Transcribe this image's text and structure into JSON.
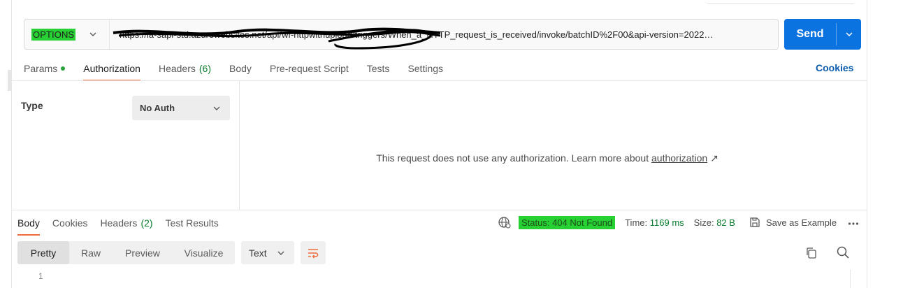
{
  "request": {
    "method": "OPTIONS",
    "url": "https://la-sapi-std.azurewebsites.net/api/wf-httpwithupload/triggers/When_a_HTTP_request_is_received/invoke/batchID%2F00&api-version=2022…",
    "send_label": "Send"
  },
  "request_tabs": [
    {
      "label": "Params"
    },
    {
      "label": "Authorization"
    },
    {
      "label": "Headers",
      "count": "(6)"
    },
    {
      "label": "Body"
    },
    {
      "label": "Pre-request Script"
    },
    {
      "label": "Tests"
    },
    {
      "label": "Settings"
    }
  ],
  "cookies_link": "Cookies",
  "auth": {
    "type_label": "Type",
    "type_value": "No Auth",
    "message": "This request does not use any authorization. Learn more about",
    "link": "authorization",
    "link_arrow": "↗"
  },
  "response_tabs": [
    {
      "label": "Body"
    },
    {
      "label": "Cookies"
    },
    {
      "label": "Headers",
      "count": "(2)"
    },
    {
      "label": "Test Results"
    }
  ],
  "response_status": {
    "status": "Status: 404 Not Found",
    "time_label": "Time:",
    "time_value": "1169 ms",
    "size_label": "Size:",
    "size_value": "82 B",
    "save_example": "Save as Example",
    "more": "ooo"
  },
  "response_view": {
    "modes": [
      "Pretty",
      "Raw",
      "Preview",
      "Visualize"
    ],
    "format": "Text",
    "first_line_number": "1"
  },
  "colors": {
    "accent_blue": "#0b73e0",
    "tab_underline": "#f26b3a",
    "highlight_green": "#27d133",
    "ok_green": "#0a7d2c"
  }
}
